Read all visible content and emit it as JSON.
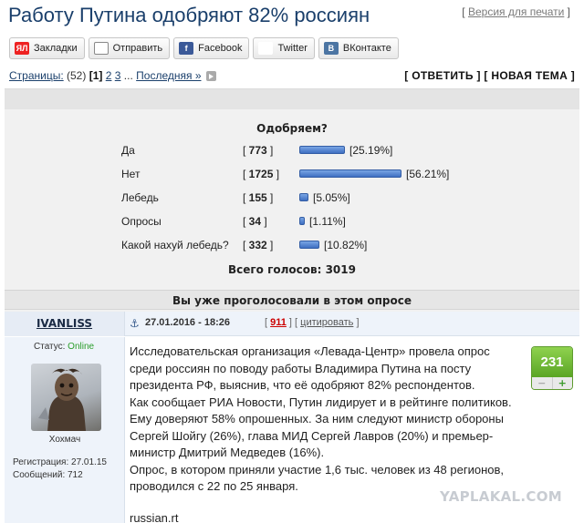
{
  "header": {
    "title": "Работу Путина одобряют 82% россиян",
    "print_label": "Версия для печати"
  },
  "share": [
    {
      "label": "Закладки",
      "icon": "yandex-bookmarks-icon",
      "glyph": "ЯЛ"
    },
    {
      "label": "Отправить",
      "icon": "mail-icon",
      "glyph": "✉"
    },
    {
      "label": "Facebook",
      "icon": "facebook-icon",
      "glyph": "f"
    },
    {
      "label": "Twitter",
      "icon": "twitter-icon",
      "glyph": "t"
    },
    {
      "label": "ВКонтакте",
      "icon": "vk-icon",
      "glyph": "В"
    }
  ],
  "pagination": {
    "label": "Страницы:",
    "count": "(52)",
    "current": "1",
    "pages": [
      "2",
      "3"
    ],
    "ellipsis": "...",
    "last": "Последняя »"
  },
  "actions": {
    "reply": "ОТВЕТИТЬ",
    "new_topic": "НОВАЯ ТЕМА"
  },
  "poll": {
    "question": "Одобряем?",
    "options": [
      {
        "label": "Да",
        "votes": "773",
        "percent": "[25.19%]",
        "share": 25.19
      },
      {
        "label": "Нет",
        "votes": "1725",
        "percent": "[56.21%]",
        "share": 56.21
      },
      {
        "label": "Лебедь",
        "votes": "155",
        "percent": "[5.05%]",
        "share": 5.05
      },
      {
        "label": "Опросы",
        "votes": "34",
        "percent": "[1.11%]",
        "share": 1.11
      },
      {
        "label": "Какой нахуй лебедь?",
        "votes": "332",
        "percent": "[10.82%]",
        "share": 10.82
      }
    ],
    "total": "Всего голосов: 3019",
    "voted_notice": "Вы уже проголосовали в этом опросе",
    "bar_color": "#4f7fd0"
  },
  "post": {
    "author": "IVANLISS",
    "date": "27.01.2016 - 18:26",
    "number": "911",
    "quote_label": "цитировать",
    "status_label": "Статус:",
    "status_value": "Online",
    "avatar_caption": "Хохмач",
    "registration": "Регистрация: 27.01.15",
    "messages": "Сообщений: 712",
    "rating": "231",
    "paragraphs": [
      "Исследовательская организация «Левада-Центр» провела опрос среди россиян по поводу работы Владимира Путина на посту президента РФ, выяснив, что её одобряют 82% респондентов.",
      "Как сообщает РИА Новости, Путин лидирует и в рейтинге политиков. Ему доверяют 58% опрошенных. За ним следуют министр обороны Сергей Шойгу (26%), глава МИД Сергей Лавров (20%) и премьер-министр Дмитрий Медведев (16%).",
      "Опрос, в котором приняли участие 1,6 тыс. человек из 48 регионов, проводился с 22 по 25 января."
    ],
    "source": "russian.rt"
  },
  "watermark": "YAPLAKAL.COM"
}
